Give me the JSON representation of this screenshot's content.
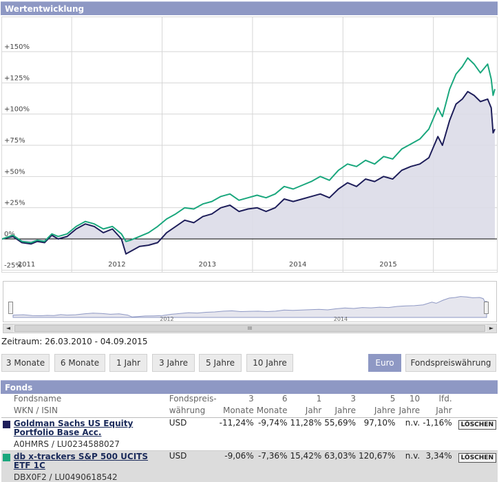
{
  "header": {
    "title": "Wertentwicklung"
  },
  "chart_data": {
    "type": "area",
    "title": "",
    "xlabel": "",
    "ylabel": "",
    "y_ticks": [
      "+150%",
      "+125%",
      "+100%",
      "+75%",
      "+50%",
      "+25%",
      "0%",
      "-25%"
    ],
    "x_ticks": [
      "2011",
      "2012",
      "2013",
      "2014",
      "2015"
    ],
    "ylim": [
      -25,
      160
    ],
    "xlim": [
      2010.23,
      2015.68
    ],
    "grid": true,
    "legend": "none",
    "series": [
      {
        "color": "#1e1e5a",
        "filled": true,
        "x": [
          2010.23,
          2010.35,
          2010.45,
          2010.55,
          2010.62,
          2010.7,
          2010.78,
          2010.85,
          2010.95,
          2011.05,
          2011.15,
          2011.25,
          2011.35,
          2011.45,
          2011.55,
          2011.6,
          2011.65,
          2011.75,
          2011.85,
          2011.95,
          2012.05,
          2012.15,
          2012.25,
          2012.35,
          2012.45,
          2012.55,
          2012.65,
          2012.75,
          2012.85,
          2012.95,
          2013.05,
          2013.15,
          2013.25,
          2013.35,
          2013.45,
          2013.55,
          2013.65,
          2013.75,
          2013.85,
          2013.95,
          2014.05,
          2014.15,
          2014.25,
          2014.35,
          2014.45,
          2014.55,
          2014.65,
          2014.75,
          2014.85,
          2014.95,
          2015.05,
          2015.1,
          2015.18,
          2015.25,
          2015.32,
          2015.38,
          2015.45,
          2015.52,
          2015.6,
          2015.64,
          2015.66,
          2015.68
        ],
        "y": [
          0,
          2,
          -3,
          -4,
          -2,
          -3,
          3,
          0,
          2,
          8,
          12,
          10,
          5,
          8,
          0,
          -12,
          -10,
          -6,
          -5,
          -3,
          5,
          10,
          15,
          13,
          18,
          20,
          25,
          27,
          22,
          24,
          25,
          22,
          25,
          32,
          30,
          32,
          34,
          36,
          33,
          40,
          45,
          42,
          48,
          46,
          50,
          48,
          55,
          58,
          60,
          65,
          82,
          75,
          95,
          108,
          112,
          118,
          115,
          110,
          112,
          105,
          85,
          88
        ]
      },
      {
        "color": "#1aa77d",
        "filled": false,
        "x": [
          2010.23,
          2010.35,
          2010.45,
          2010.55,
          2010.62,
          2010.7,
          2010.78,
          2010.85,
          2010.95,
          2011.05,
          2011.15,
          2011.25,
          2011.35,
          2011.45,
          2011.55,
          2011.6,
          2011.65,
          2011.75,
          2011.85,
          2011.95,
          2012.05,
          2012.15,
          2012.25,
          2012.35,
          2012.45,
          2012.55,
          2012.65,
          2012.75,
          2012.85,
          2012.95,
          2013.05,
          2013.15,
          2013.25,
          2013.35,
          2013.45,
          2013.55,
          2013.65,
          2013.75,
          2013.85,
          2013.95,
          2014.05,
          2014.15,
          2014.25,
          2014.35,
          2014.45,
          2014.55,
          2014.65,
          2014.75,
          2014.85,
          2014.95,
          2015.05,
          2015.1,
          2015.18,
          2015.25,
          2015.32,
          2015.38,
          2015.45,
          2015.52,
          2015.6,
          2015.64,
          2015.66,
          2015.68
        ],
        "y": [
          0,
          3,
          -2,
          -3,
          -1,
          -2,
          4,
          2,
          4,
          10,
          14,
          12,
          8,
          10,
          4,
          -2,
          -1,
          2,
          5,
          10,
          16,
          20,
          25,
          24,
          28,
          30,
          34,
          36,
          31,
          33,
          35,
          33,
          36,
          42,
          40,
          43,
          46,
          50,
          47,
          55,
          60,
          58,
          63,
          60,
          66,
          64,
          72,
          76,
          80,
          88,
          105,
          98,
          120,
          132,
          138,
          145,
          140,
          133,
          140,
          128,
          115,
          120
        ]
      }
    ]
  },
  "navigator": {
    "ticks": [
      "2012",
      "2014"
    ],
    "scroll_grip": "III",
    "left_arrow": "◄",
    "right_arrow": "►"
  },
  "zeitraum": "Zeitraum: 26.03.2010 - 04.09.2015",
  "range_buttons": [
    "3 Monate",
    "6 Monate",
    "1 Jahr",
    "3 Jahre",
    "5 Jahre",
    "10 Jahre"
  ],
  "currency_buttons": {
    "euro": "Euro",
    "fondspreis": "Fondspreiswährung"
  },
  "colors": {
    "accent": "#8e98c4",
    "fund1": "#1e1e5a",
    "fund2": "#1aa77d"
  },
  "fonds": {
    "title": "Fonds",
    "head1": {
      "name": "Fondsname",
      "waehrung": "Fondspreis-",
      "m3": "3",
      "m6": "6",
      "j1": "1",
      "j3": "3",
      "j5": "5",
      "j10": "10",
      "lfd": "lfd."
    },
    "head2": {
      "name": "WKN / ISIN",
      "waehrung": "währung",
      "m3": "Monate",
      "m6": "Monate",
      "j1": "Jahr",
      "j3": "Jahre",
      "j5": "Jahre",
      "j10": "Jahre",
      "lfd": "Jahr"
    },
    "rows": [
      {
        "name": "Goldman Sachs US Equity Portfolio Base Acc.",
        "wkn": "A0HMRS / LU0234588027",
        "currency": "USD",
        "m3": "-11,24%",
        "m6": "-9,74%",
        "j1": "11,28%",
        "j3": "55,69%",
        "j5": "97,10%",
        "j10": "n.v.",
        "lfd": "-1,16%",
        "action": "LÖSCHEN"
      },
      {
        "name": "db x-trackers S&P 500 UCITS ETF 1C",
        "wkn": "DBX0F2 / LU0490618542",
        "currency": "USD",
        "m3": "-9,06%",
        "m6": "-7,36%",
        "j1": "15,42%",
        "j3": "63,03%",
        "j5": "120,67%",
        "j10": "n.v.",
        "lfd": "3,34%",
        "action": "LÖSCHEN"
      }
    ]
  }
}
